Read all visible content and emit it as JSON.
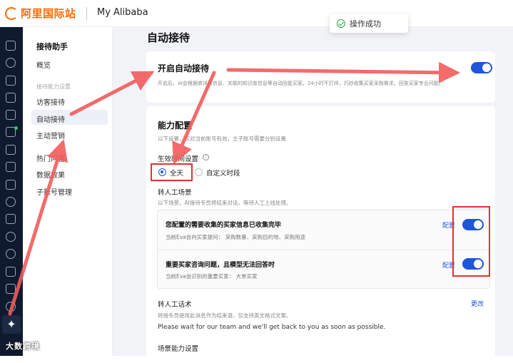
{
  "header": {
    "brand": "阿里国际站",
    "app_title": "My Alibaba"
  },
  "toast": {
    "text": "操作成功"
  },
  "rail": {
    "icons": [
      "home-icon",
      "star-icon",
      "bag-icon",
      "shop-icon",
      "video-icon",
      "chart-icon",
      "doc-icon",
      "ticket-icon",
      "message-icon",
      "users-icon",
      "clipboard-icon",
      "globe-icon",
      "bell-icon",
      "money-icon",
      "shield-icon",
      "share-icon",
      "ai-assistant-icon"
    ]
  },
  "sidebar": {
    "title": "接待助手",
    "overview": "概览",
    "section": "接待能力设置",
    "items": [
      "访客接待",
      "自动接待",
      "主动营销"
    ],
    "items2": [
      "热门问答",
      "数据效果",
      "子账号管理"
    ]
  },
  "page": {
    "title": "自动接待"
  },
  "auto_card": {
    "title": "开启自动接待",
    "desc": "开启后，AI会根据商详页信息、关联的知识库信息等自动回复买家。24小时不打烊，巧妙收集买家采购需求，回答买家专业问题。",
    "enabled": true
  },
  "ability": {
    "title": "能力配置",
    "desc": "以下设置，仅对当前账号有效，主子账号需要分别设置",
    "time_label": "生效时间设置",
    "time_options": [
      "全天",
      "自定义时段"
    ],
    "time_selected": "全天",
    "transfer_label": "转人工场景",
    "transfer_desc": "以下场景，AI接待专员将结束对话，等待人工上线处理。",
    "scenes": [
      {
        "title": "您配置的需要收集的买家信息已收集完毕",
        "desc": "当前Eva会向买家提问：  采购数量、采购目的地、采购用途",
        "config": "配置",
        "enabled": true
      },
      {
        "title": "重要买家咨询问题，且模型无法回答时",
        "desc": "当前Eva会识别的重要买家：  大单买家",
        "config": "配置",
        "enabled": true
      }
    ],
    "script_label": "转人工话术",
    "script_edit": "更改",
    "script_desc": "转接专员使用此消息作为结束语，仅支持英文格式文案。",
    "script_text": "Please wait for our team and we'll get back to you as soon as possible.",
    "scene_ability_label": "场景能力设置"
  },
  "watermark": "大数跨境",
  "annotation_color": "#e53030"
}
